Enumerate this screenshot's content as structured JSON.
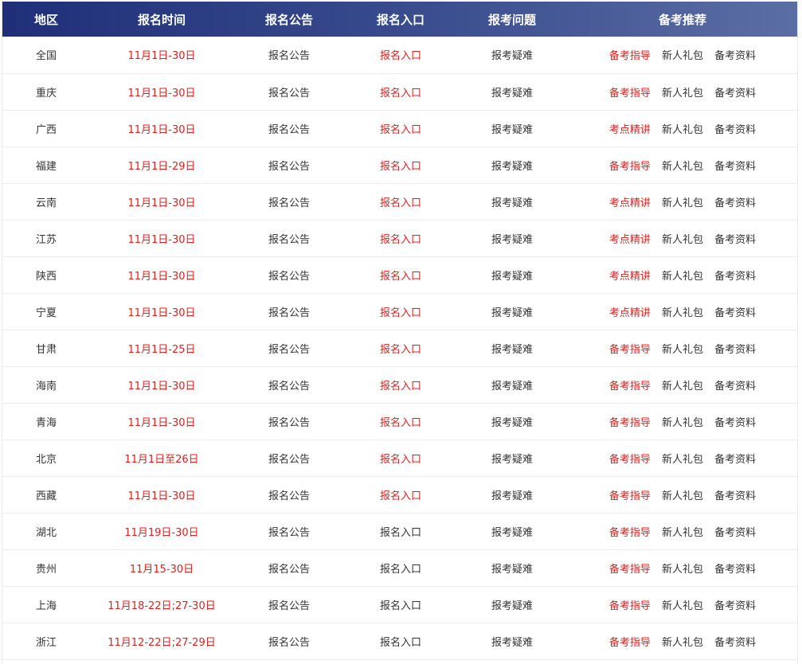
{
  "header": {
    "region": "地区",
    "time": "报名时间",
    "notice": "报名公告",
    "entry": "报名入口",
    "faq": "报考问题",
    "rec": "备考推荐"
  },
  "colors": {
    "header_bg_start": "#1f2f78",
    "header_bg_end": "#5b6ea4",
    "accent_red": "#e02020",
    "text_dark": "#333333"
  },
  "rows": [
    {
      "region": "全国",
      "time": "11月1日-30日",
      "notice": "报名公告",
      "entry": "报名入口",
      "entry_active": true,
      "faq": "报考疑难",
      "rec1": "备考指导",
      "rec2": "新人礼包",
      "rec3": "备考资料"
    },
    {
      "region": "重庆",
      "time": "11月1日-30日",
      "notice": "报名公告",
      "entry": "报名入口",
      "entry_active": true,
      "faq": "报考疑难",
      "rec1": "备考指导",
      "rec2": "新人礼包",
      "rec3": "备考资料"
    },
    {
      "region": "广西",
      "time": "11月1日-30日",
      "notice": "报名公告",
      "entry": "报名入口",
      "entry_active": true,
      "faq": "报考疑难",
      "rec1": "考点精讲",
      "rec2": "新人礼包",
      "rec3": "备考资料"
    },
    {
      "region": "福建",
      "time": "11月1日-29日",
      "notice": "报名公告",
      "entry": "报名入口",
      "entry_active": true,
      "faq": "报考疑难",
      "rec1": "备考指导",
      "rec2": "新人礼包",
      "rec3": "备考资料"
    },
    {
      "region": "云南",
      "time": "11月1日-30日",
      "notice": "报名公告",
      "entry": "报名入口",
      "entry_active": true,
      "faq": "报考疑难",
      "rec1": "考点精讲",
      "rec2": "新人礼包",
      "rec3": "备考资料"
    },
    {
      "region": "江苏",
      "time": "11月1日-30日",
      "notice": "报名公告",
      "entry": "报名入口",
      "entry_active": true,
      "faq": "报考疑难",
      "rec1": "考点精讲",
      "rec2": "新人礼包",
      "rec3": "备考资料"
    },
    {
      "region": "陕西",
      "time": "11月1日-30日",
      "notice": "报名公告",
      "entry": "报名入口",
      "entry_active": true,
      "faq": "报考疑难",
      "rec1": "考点精讲",
      "rec2": "新人礼包",
      "rec3": "备考资料"
    },
    {
      "region": "宁夏",
      "time": "11月1日-30日",
      "notice": "报名公告",
      "entry": "报名入口",
      "entry_active": true,
      "faq": "报考疑难",
      "rec1": "考点精讲",
      "rec2": "新人礼包",
      "rec3": "备考资料"
    },
    {
      "region": "甘肃",
      "time": "11月1日-25日",
      "notice": "报名公告",
      "entry": "报名入口",
      "entry_active": true,
      "faq": "报考疑难",
      "rec1": "备考指导",
      "rec2": "新人礼包",
      "rec3": "备考资料"
    },
    {
      "region": "海南",
      "time": "11月1日-30日",
      "notice": "报名公告",
      "entry": "报名入口",
      "entry_active": true,
      "faq": "报考疑难",
      "rec1": "备考指导",
      "rec2": "新人礼包",
      "rec3": "备考资料"
    },
    {
      "region": "青海",
      "time": "11月1日-30日",
      "notice": "报名公告",
      "entry": "报名入口",
      "entry_active": true,
      "faq": "报考疑难",
      "rec1": "备考指导",
      "rec2": "新人礼包",
      "rec3": "备考资料"
    },
    {
      "region": "北京",
      "time": "11月1日至26日",
      "notice": "报名公告",
      "entry": "报名入口",
      "entry_active": true,
      "faq": "报考疑难",
      "rec1": "备考指导",
      "rec2": "新人礼包",
      "rec3": "备考资料"
    },
    {
      "region": "西藏",
      "time": "11月1日-30日",
      "notice": "报名公告",
      "entry": "报名入口",
      "entry_active": true,
      "faq": "报考疑难",
      "rec1": "备考指导",
      "rec2": "新人礼包",
      "rec3": "备考资料"
    },
    {
      "region": "湖北",
      "time": "11月19日-30日",
      "notice": "报名公告",
      "entry": "报名入口",
      "entry_active": false,
      "faq": "报考疑难",
      "rec1": "备考指导",
      "rec2": "新人礼包",
      "rec3": "备考资料"
    },
    {
      "region": "贵州",
      "time": "11月15-30日",
      "notice": "报名公告",
      "entry": "报名入口",
      "entry_active": false,
      "faq": "报考疑难",
      "rec1": "备考指导",
      "rec2": "新人礼包",
      "rec3": "备考资料"
    },
    {
      "region": "上海",
      "time": "11月18-22日;27-30日",
      "notice": "报名公告",
      "entry": "报名入口",
      "entry_active": false,
      "faq": "报考疑难",
      "rec1": "备考指导",
      "rec2": "新人礼包",
      "rec3": "备考资料"
    },
    {
      "region": "浙江",
      "time": "11月12-22日;27-29日",
      "notice": "报名公告",
      "entry": "报名入口",
      "entry_active": false,
      "faq": "报考疑难",
      "rec1": "备考指导",
      "rec2": "新人礼包",
      "rec3": "备考资料"
    }
  ]
}
